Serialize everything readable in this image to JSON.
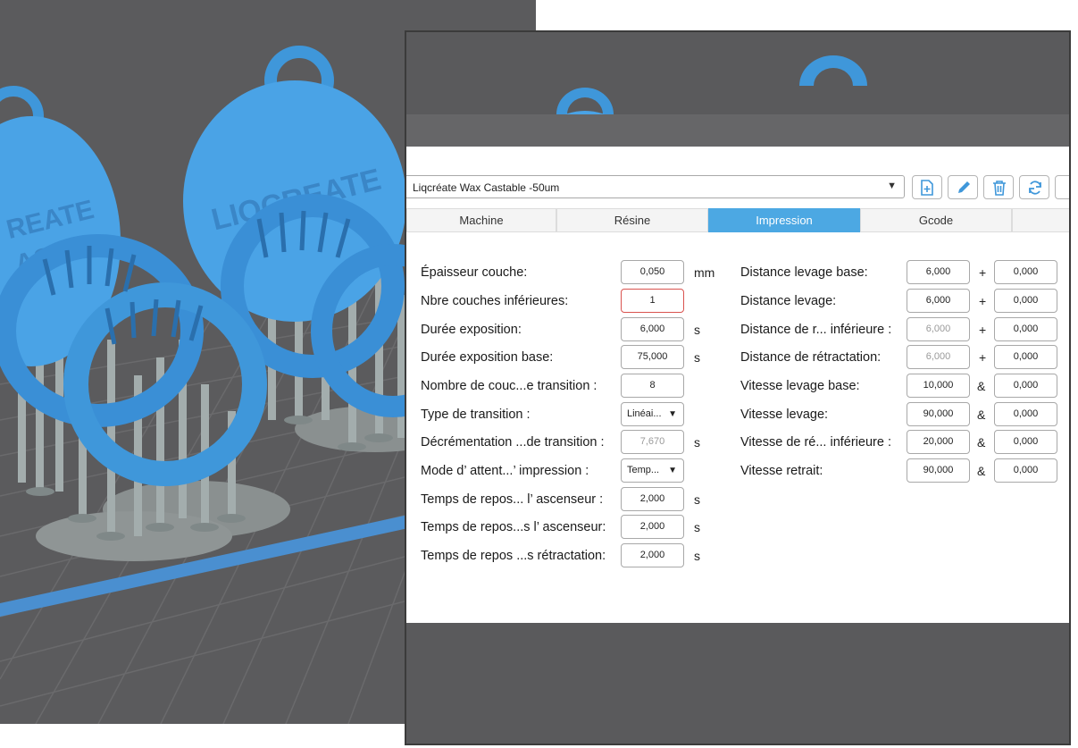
{
  "profile": {
    "name": "Liqcréate Wax Castable -50um"
  },
  "tabs": [
    "Machine",
    "Résine",
    "Impression",
    "Gcode"
  ],
  "active_tab": "Impression",
  "viewport_text": {
    "main_medallion": "LIQCREATE",
    "left_medallion_line1": "REATE",
    "left_medallion_line2": "AST"
  },
  "left_fields": [
    {
      "label": "Épaisseur couche:",
      "value": "0,050",
      "unit": "mm"
    },
    {
      "label": "Nbre couches inférieures:",
      "value": "1",
      "unit": ""
    },
    {
      "label": "Durée exposition:",
      "value": "6,000",
      "unit": "s"
    },
    {
      "label": "Durée exposition base:",
      "value": "75,000",
      "unit": "s"
    },
    {
      "label": "Nombre de couc...e transition :",
      "value": "8",
      "unit": ""
    },
    {
      "label": "Type de transition :",
      "value": "Linéai...",
      "unit": ""
    },
    {
      "label": "Décrémentation ...de transition :",
      "value": "7,670",
      "unit": "s"
    },
    {
      "label": "Mode d’ attent...’ impression :",
      "value": "Temp...",
      "unit": ""
    },
    {
      "label": "Temps de repos... l’ ascenseur :",
      "value": "2,000",
      "unit": "s"
    },
    {
      "label": "Temps de repos...s l’ ascenseur:",
      "value": "2,000",
      "unit": "s"
    },
    {
      "label": "Temps de repos ...s rétractation:",
      "value": "2,000",
      "unit": "s"
    }
  ],
  "right_fields": [
    {
      "label": "Distance levage base:",
      "value": "6,000",
      "op": "+",
      "value2": "0,000"
    },
    {
      "label": "Distance levage:",
      "value": "6,000",
      "op": "+",
      "value2": "0,000"
    },
    {
      "label": "Distance de r... inférieure :",
      "value": "6,000",
      "op": "+",
      "value2": "0,000"
    },
    {
      "label": "Distance de rétractation:",
      "value": "6,000",
      "op": "+",
      "value2": "0,000"
    },
    {
      "label": "Vitesse levage base:",
      "value": "10,000",
      "op": "&",
      "value2": "0,000"
    },
    {
      "label": "Vitesse levage:",
      "value": "90,000",
      "op": "&",
      "value2": "0,000"
    },
    {
      "label": "Vitesse de ré... inférieure :",
      "value": "20,000",
      "op": "&",
      "value2": "0,000"
    },
    {
      "label": "Vitesse retrait:",
      "value": "90,000",
      "op": "&",
      "value2": "0,000"
    }
  ],
  "icons": [
    "new-file-icon",
    "pencil-icon",
    "trash-icon",
    "refresh-icon"
  ],
  "colors": {
    "accent": "#4ca8e3",
    "model_blue": "#3f97da",
    "support_gray": "#9aa4a4",
    "viewport_bg": "#5b5b5d"
  }
}
